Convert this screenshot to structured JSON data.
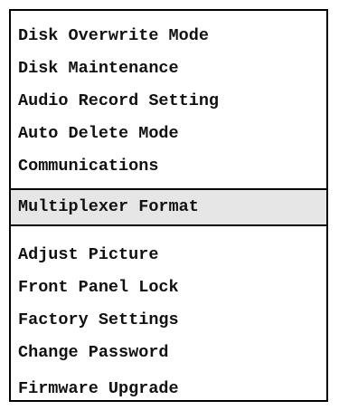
{
  "menu": {
    "top_items": [
      {
        "label": "Disk Overwrite Mode"
      },
      {
        "label": "Disk Maintenance"
      },
      {
        "label": "Audio Record Setting"
      },
      {
        "label": "Auto Delete Mode"
      },
      {
        "label": "Communications"
      }
    ],
    "highlighted_item": {
      "label": "Multiplexer Format"
    },
    "bottom_items": [
      {
        "label": "Adjust Picture"
      },
      {
        "label": "Front Panel Lock"
      },
      {
        "label": "Factory Settings"
      },
      {
        "label": "Change Password"
      },
      {
        "label": "Firmware Upgrade"
      }
    ]
  }
}
